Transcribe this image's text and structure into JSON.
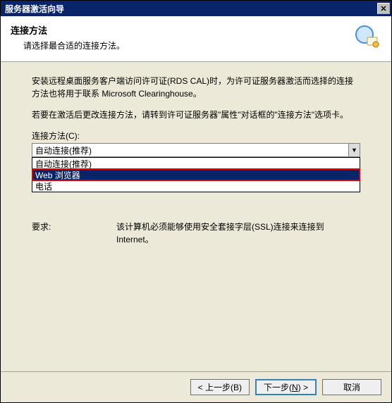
{
  "window": {
    "title": "服务器激活向导"
  },
  "header": {
    "heading": "连接方法",
    "subheading": "请选择最合适的连接方法。"
  },
  "intro": {
    "para1": "安装远程桌面服务客户端访问许可证(RDS CAL)时，为许可证服务器激活而选择的连接方法也将用于联系 Microsoft Clearinghouse。",
    "para2": "若要在激活后更改连接方法，请转到许可证服务器\"属性\"对话框的\"连接方法\"选项卡。"
  },
  "field": {
    "label": "连接方法(C):",
    "selected": "自动连接(推荐)",
    "options": [
      "自动连接(推荐)",
      "Web 浏览器",
      "电话"
    ],
    "highlightedIndex": 1
  },
  "requirements": {
    "label": "要求:",
    "text": "该计算机必须能够使用安全套接字层(SSL)连接来连接到 Internet。"
  },
  "buttons": {
    "back": "< 上一步(B)",
    "next_prefix": "下一步(",
    "next_key": "N",
    "next_suffix": ") >",
    "cancel": "取消"
  }
}
